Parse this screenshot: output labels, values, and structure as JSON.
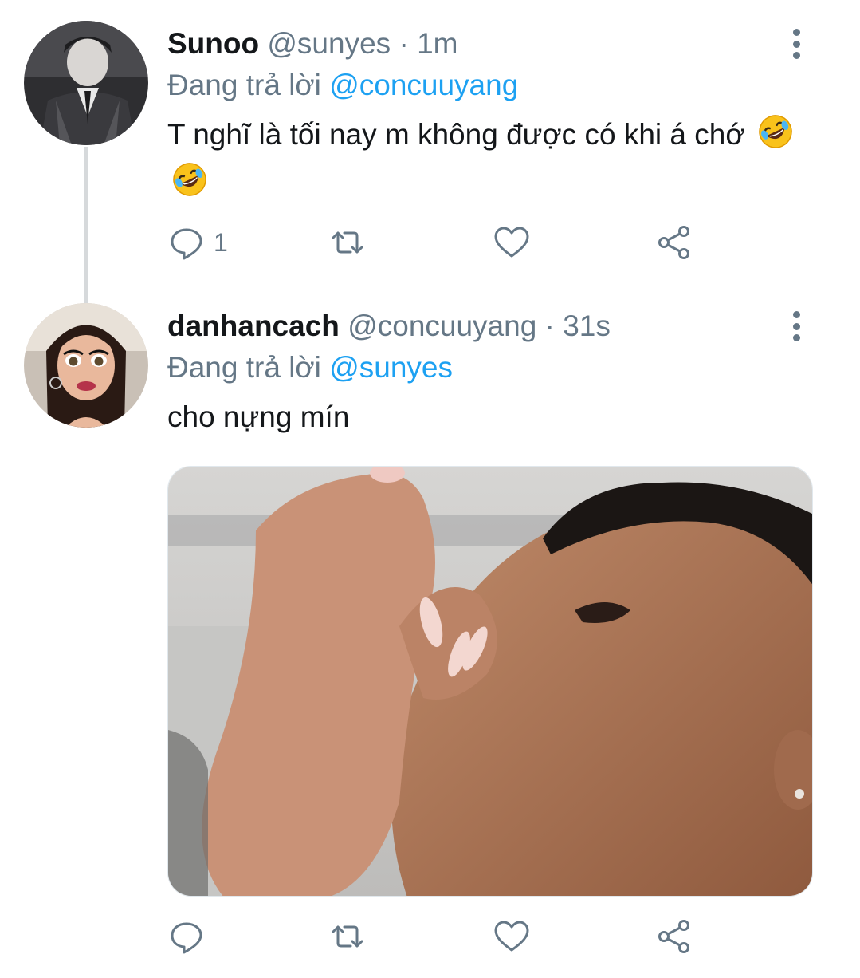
{
  "tweets": [
    {
      "name": "Sunoo",
      "handle": "@sunyes",
      "separator": "·",
      "time": "1m",
      "reply_prefix": "Đang trả lời",
      "reply_to": "@concuuyang",
      "text": "T nghĩ là tối nay m không được có khi á chớ",
      "emoji": [
        "rolling-on-floor-laughing",
        "rolling-on-floor-laughing"
      ],
      "reply_count": "1",
      "retweet_count": "",
      "like_count": ""
    },
    {
      "name": "danhancach",
      "handle": "@concuuyang",
      "separator": "·",
      "time": "31s",
      "reply_prefix": "Đang trả lời",
      "reply_to": "@sunyes",
      "text": "cho nựng mín",
      "reply_count": "",
      "retweet_count": "",
      "like_count": ""
    }
  ],
  "colors": {
    "accent": "#1da1f2",
    "secondary_text": "#657786",
    "primary_text": "#14171a",
    "thread_line": "#d6d9db"
  },
  "icons": [
    "reply-icon",
    "retweet-icon",
    "like-icon",
    "share-icon",
    "more-options-icon"
  ]
}
